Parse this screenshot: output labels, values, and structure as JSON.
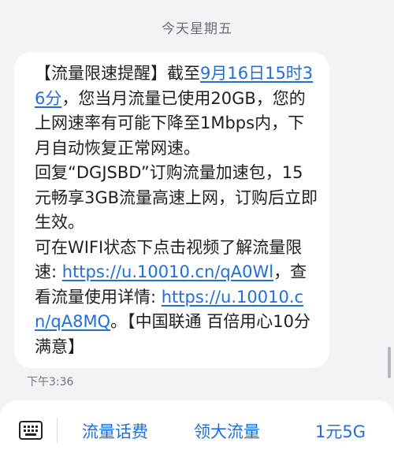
{
  "header": {
    "day": "今天星期五"
  },
  "message": {
    "seg_0": "【流量限速提醒】截至",
    "link_date": "9月16日15时36分",
    "seg_1": "，您当月流量已使用20GB，您的上网速率有可能下降至1Mbps内，下月自动恢复正常网速。",
    "seg_2": " 回复“DGJSBD”订购流量加速包，15元畅享3GB流量高速上网，订购后立即生效。",
    "seg_3": " 可在WIFI状态下点击视频了解流量限速: ",
    "link_1": "https://u.10010.cn/qA0Wl",
    "seg_4": "，查看流量使用详情: ",
    "link_2": "https://u.10010.cn/qA8MQ",
    "seg_5": "。【中国联通 百倍用心10分满意】",
    "time": "下午3:36"
  },
  "bottom_menu": {
    "keyboard_icon": "keyboard-icon",
    "items": [
      "流量话费",
      "领大流量",
      "1元5G"
    ]
  },
  "colors": {
    "link": "#1e6fd9",
    "background": "#f1f3f6",
    "bubble": "#ffffff"
  }
}
